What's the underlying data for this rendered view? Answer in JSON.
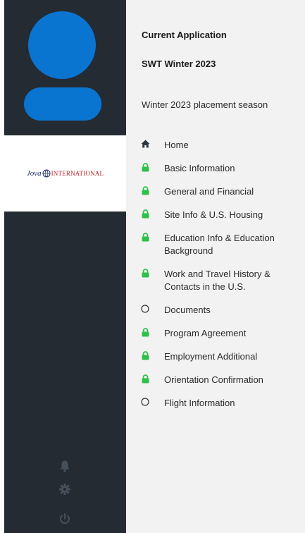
{
  "sidebar": {
    "logo": {
      "script": "Jova",
      "word": "INTERNATIONAL"
    },
    "bottom_icons": [
      {
        "icon": "bell-icon"
      },
      {
        "icon": "gear-icon"
      },
      {
        "icon": "power-icon"
      }
    ]
  },
  "application": {
    "heading": "Current Application",
    "name": "SWT Winter 2023",
    "season": "Winter 2023 placement season"
  },
  "nav": {
    "items": [
      {
        "label": "Home",
        "icon": "home-icon"
      },
      {
        "label": "Basic Information",
        "icon": "lock-icon"
      },
      {
        "label": "General and Financial",
        "icon": "lock-icon"
      },
      {
        "label": "Site Info & U.S. Housing",
        "icon": "lock-icon"
      },
      {
        "label": "Education Info & Education Background",
        "icon": "lock-icon"
      },
      {
        "label": "Work and Travel History & Contacts in the U.S.",
        "icon": "lock-icon"
      },
      {
        "label": "Documents",
        "icon": "circle-icon"
      },
      {
        "label": "Program Agreement",
        "icon": "lock-icon"
      },
      {
        "label": "Employment Additional",
        "icon": "lock-icon"
      },
      {
        "label": "Orientation Confirmation",
        "icon": "lock-icon"
      },
      {
        "label": "Flight Information",
        "icon": "circle-icon"
      }
    ]
  },
  "colors": {
    "sidebar_bg": "#242b33",
    "avatar": "#0a74d1",
    "lock_green": "#2fbf4a",
    "sidebar_icon": "#46505b"
  }
}
